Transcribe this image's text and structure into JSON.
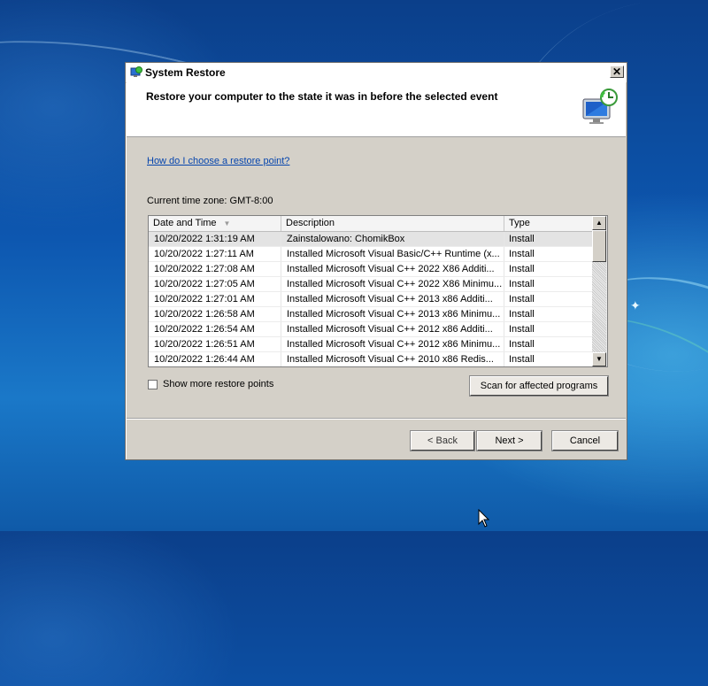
{
  "window": {
    "title": "System Restore",
    "close_glyph": "✕",
    "icon": "system-restore-icon"
  },
  "header": {
    "title": "Restore your computer to the state it was in before the selected event",
    "icon": "restore-monitor-icon"
  },
  "help_link": "How do I choose a restore point?",
  "timezone": "Current time zone: GMT-8:00",
  "list": {
    "columns": [
      "Date and Time",
      "Description",
      "Type"
    ],
    "rows": [
      [
        "10/20/2022 1:31:19 AM",
        "Zainstalowano: ChomikBox",
        "Install"
      ],
      [
        "10/20/2022 1:27:11 AM",
        "Installed Microsoft Visual Basic/C++ Runtime (x...",
        "Install"
      ],
      [
        "10/20/2022 1:27:08 AM",
        "Installed Microsoft Visual C++ 2022 X86 Additi...",
        "Install"
      ],
      [
        "10/20/2022 1:27:05 AM",
        "Installed Microsoft Visual C++ 2022 X86 Minimu...",
        "Install"
      ],
      [
        "10/20/2022 1:27:01 AM",
        "Installed Microsoft Visual C++ 2013 x86 Additi...",
        "Install"
      ],
      [
        "10/20/2022 1:26:58 AM",
        "Installed Microsoft Visual C++ 2013 x86 Minimu...",
        "Install"
      ],
      [
        "10/20/2022 1:26:54 AM",
        "Installed Microsoft Visual C++ 2012 x86 Additi...",
        "Install"
      ],
      [
        "10/20/2022 1:26:51 AM",
        "Installed Microsoft Visual C++ 2012 x86 Minimu...",
        "Install"
      ],
      [
        "10/20/2022 1:26:44 AM",
        "Installed Microsoft Visual C++ 2010  x86 Redis...",
        "Install"
      ]
    ],
    "selected_row": 0
  },
  "show_more_label": "Show more restore points",
  "buttons": {
    "scan": "Scan for affected programs",
    "back": "< Back",
    "next": "Next >",
    "cancel": "Cancel"
  },
  "colors": {
    "link": "#0645ad",
    "dialog_bg": "#d4d0c8",
    "desktop": "#0d57b0"
  }
}
